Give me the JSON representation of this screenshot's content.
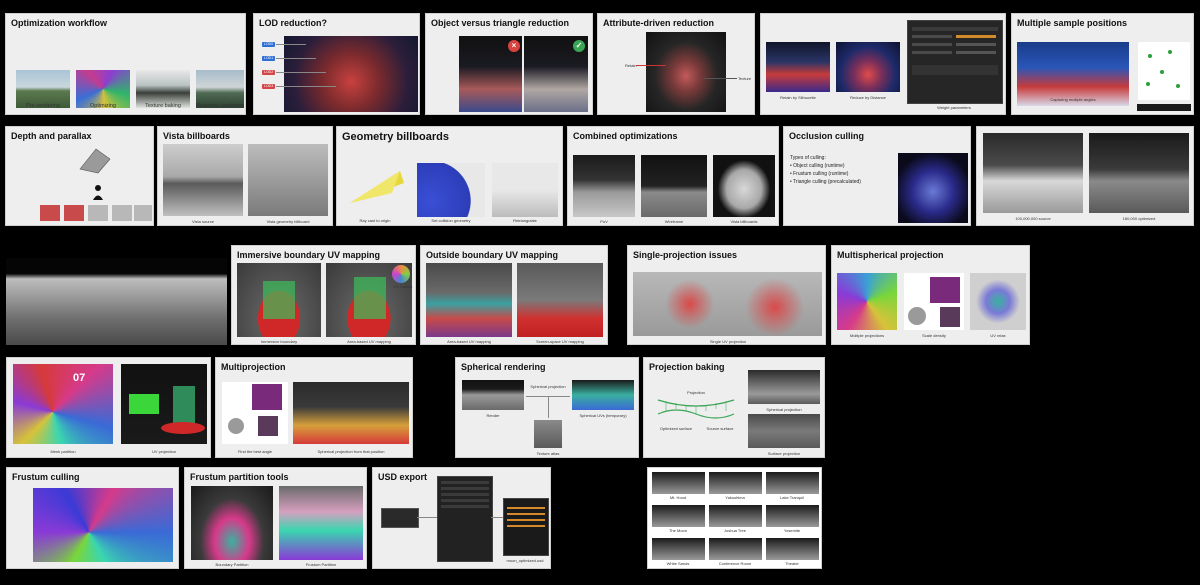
{
  "slides": {
    "optimization_workflow": {
      "title": "Optimization workflow",
      "captions": [
        "Pre-rendering",
        "Optimizing",
        "Texture baking",
        "Real-time rendering"
      ]
    },
    "lod_reduction": {
      "title": "LOD reduction?",
      "lod_labels": [
        "LOD0",
        "LOD1",
        "LOD2",
        "LOD3"
      ]
    },
    "object_vs_triangle": {
      "title": "Object versus triangle reduction"
    },
    "attribute_driven": {
      "title": "Attribute-driven reduction",
      "annotations": [
        "Retain",
        "Texture"
      ]
    },
    "weight_parameters": {
      "captions": [
        "Retain by Silhouette",
        "Reduce by Distance",
        "Weight parameters"
      ]
    },
    "multiple_sample_positions": {
      "title": "Multiple sample positions",
      "caption": "Capturing multiple angles"
    },
    "depth_parallax": {
      "title": "Depth and parallax"
    },
    "vista_billboards": {
      "title": "Vista billboards",
      "captions": [
        "Vista source",
        "Vista geometry billboard"
      ]
    },
    "geometry_billboards": {
      "title": "Geometry billboards",
      "captions": [
        "Ray cast to origin",
        "Set collision geometry",
        "Retriangulate"
      ]
    },
    "combined_optimizations": {
      "title": "Combined optimizations",
      "captions": [
        "PoV",
        "Wireframe",
        "Vista billboards"
      ]
    },
    "occlusion_culling": {
      "title": "Occlusion culling",
      "heading": "Types of culling:",
      "bullets": [
        "• Object culling (runtime)",
        "• Frustum culling (runtime)",
        "• Triangle culling (precalculated)"
      ]
    },
    "source_optimized": {
      "captions": [
        "100,000,000 source",
        "180,000 optimized"
      ]
    },
    "immersive_boundary": {
      "title": "Immersive boundary UV mapping",
      "captions": [
        "Immersive boundary",
        "Area-based UV mapping"
      ],
      "inset_label": "UV Layout"
    },
    "outside_boundary": {
      "title": "Outside boundary UV mapping",
      "captions": [
        "Area-based UV mapping",
        "Screen-space UV mapping"
      ]
    },
    "single_projection": {
      "title": "Single-projection issues",
      "caption": "Single UV projection"
    },
    "multispherical": {
      "title": "Multispherical projection",
      "captions": [
        "Multiple projections",
        "Scale density",
        "UV relax"
      ]
    },
    "mesh_partition": {
      "captions": [
        "Mesh partition",
        "UV projection"
      ],
      "sign": "07"
    },
    "multiprojection": {
      "title": "Multiprojection",
      "captions": [
        "Find the best angle",
        "Spherical projection from that position"
      ]
    },
    "spherical_rendering": {
      "title": "Spherical rendering",
      "captions": [
        "Render",
        "Spherical UVs (temporary)",
        "Texture atlas"
      ],
      "arrow_label": "Spherical projection"
    },
    "projection_baking": {
      "title": "Projection baking",
      "diagram_labels": [
        "Projection",
        "Optimized surface",
        "Source surface"
      ],
      "captions": [
        "Spherical projection",
        "Surface projection"
      ]
    },
    "frustum_culling": {
      "title": "Frustum culling"
    },
    "frustum_partition": {
      "title": "Frustum partition tools",
      "captions": [
        "Boundary Partition",
        "Frustum Partition"
      ]
    },
    "usd_export": {
      "title": "USD export",
      "file_caption": "moon_optimized.usd"
    },
    "environments": {
      "captions": [
        "Mt. Hood",
        "Yakushima",
        "Lake Tranquil",
        "The Moon",
        "Joshua Tree",
        "Yosemite",
        "White Sands",
        "Conference Room",
        "Theater"
      ]
    }
  },
  "colors": {
    "slide_bg": "#eeeeee",
    "page_bg": "#000000",
    "red_badge": "#d9433f",
    "green_badge": "#3aa655",
    "lod_blue": "#2d6fd6",
    "lod_red": "#d64545"
  }
}
